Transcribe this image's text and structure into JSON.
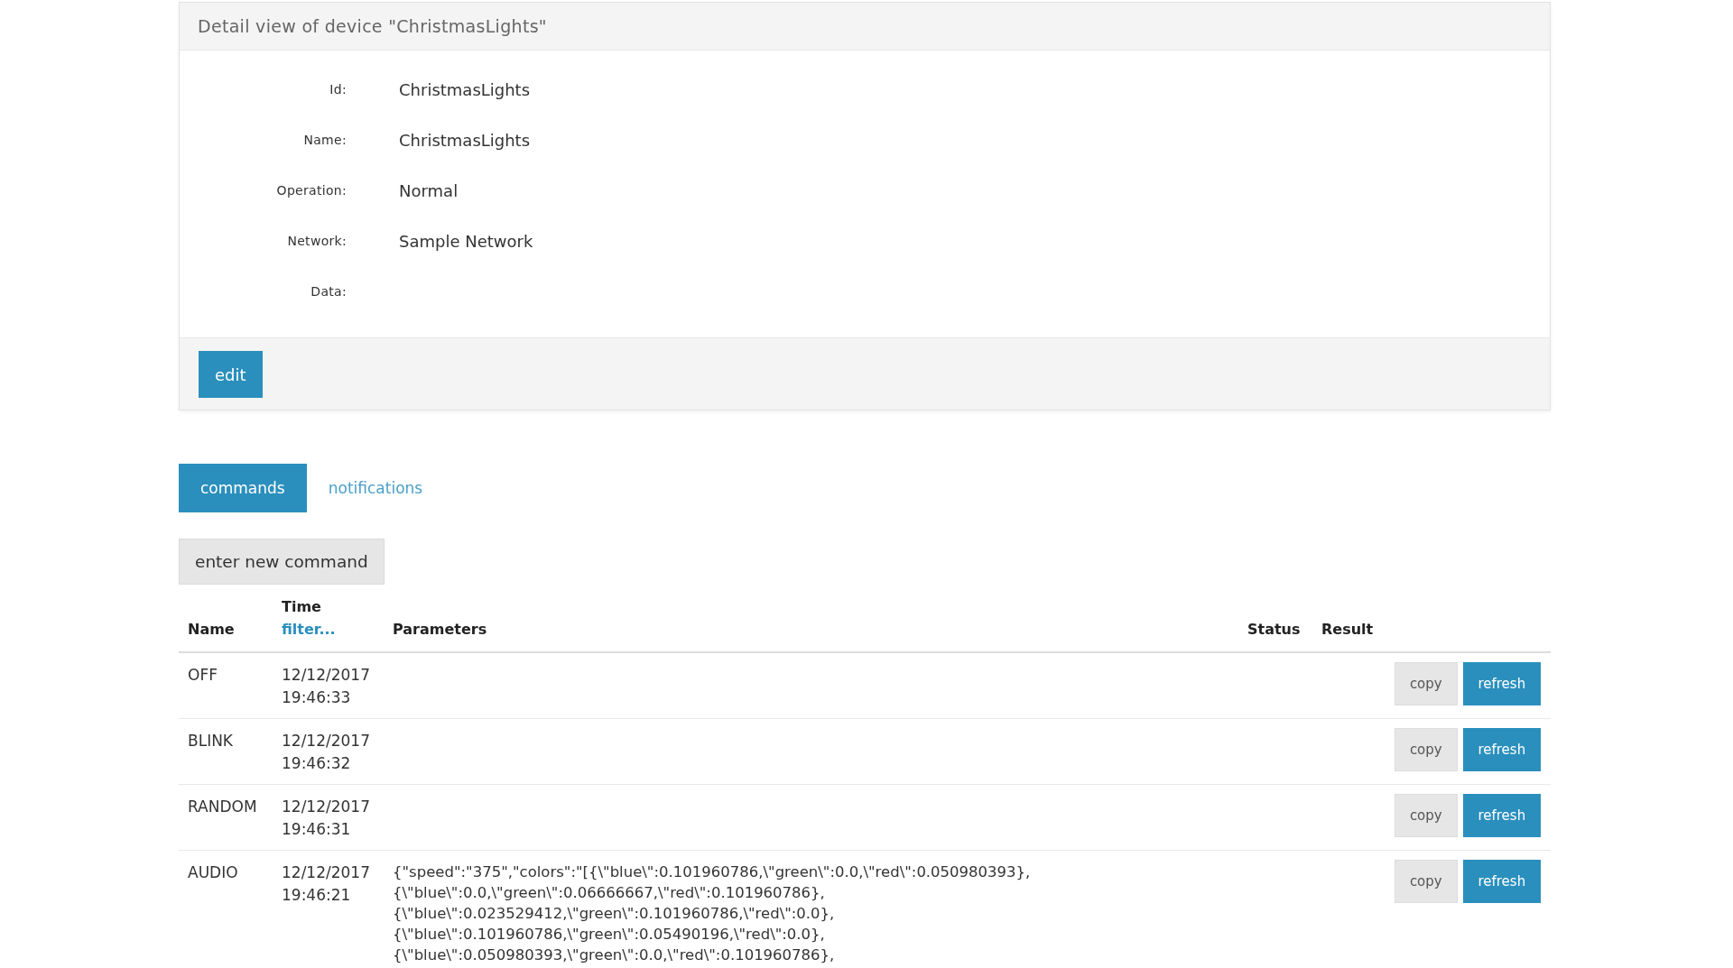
{
  "panel": {
    "title": "Detail view of device \"ChristmasLights\"",
    "fields": [
      {
        "label": "Id:",
        "value": "ChristmasLights"
      },
      {
        "label": "Name:",
        "value": "ChristmasLights"
      },
      {
        "label": "Operation:",
        "value": "Normal"
      },
      {
        "label": "Network:",
        "value": "Sample Network"
      },
      {
        "label": "Data:"
      }
    ],
    "edit_button": "edit"
  },
  "tabs": [
    {
      "label": "commands",
      "selected": true
    },
    {
      "label": "notifications",
      "selected": false
    }
  ],
  "new_command_button": "enter new command",
  "table": {
    "columns": [
      {
        "label": "Name"
      },
      {
        "label": "Time",
        "filter": "filter..."
      },
      {
        "label": "Parameters"
      },
      {
        "label": "Status"
      },
      {
        "label": "Result"
      }
    ],
    "rows": [
      {
        "name": "OFF",
        "time": "12/12/2017 19:46:33",
        "copy": "copy",
        "refresh": "refresh"
      },
      {
        "name": "BLINK",
        "time": "12/12/2017 19:46:32",
        "copy": "copy",
        "refresh": "refresh"
      },
      {
        "name": "RANDOM",
        "time": "12/12/2017 19:46:31",
        "copy": "copy",
        "refresh": "refresh"
      },
      {
        "name": "AUDIO",
        "time": "12/12/2017 19:46:21",
        "parameters": "{\"speed\":\"375\",\"colors\":\"[{\\\"blue\\\":0.101960786,\\\"green\\\":0.0,\\\"red\\\":0.050980393},\n{\\\"blue\\\":0.0,\\\"green\\\":0.06666667,\\\"red\\\":0.101960786},\n{\\\"blue\\\":0.023529412,\\\"green\\\":0.101960786,\\\"red\\\":0.0},\n{\\\"blue\\\":0.101960786,\\\"green\\\":0.05490196,\\\"red\\\":0.0},\n{\\\"blue\\\":0.050980393,\\\"green\\\":0.0,\\\"red\\\":0.101960786},",
        "copy": "copy",
        "refresh": "refresh"
      }
    ]
  }
}
